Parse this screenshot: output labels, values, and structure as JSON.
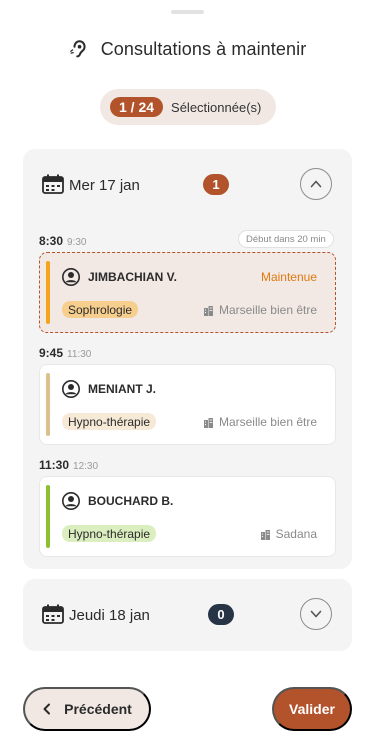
{
  "header": {
    "title": "Consultations à maintenir",
    "icon": "ear-icon"
  },
  "selection": {
    "count": "1 / 24",
    "label": "Sélectionnée(s)"
  },
  "days": [
    {
      "label": "Mer 17 jan",
      "count": "1",
      "expanded": true,
      "slots": [
        {
          "start": "8:30",
          "end": "9:30",
          "start_hint": "Début dans 20 min",
          "patient": "JIMBACHIAN V.",
          "status": "Maintenue",
          "therapy": "Sophrologie",
          "place": "Marseille bien être",
          "selected": true,
          "bar_color": "#f5a31b",
          "tag_color": "#f6cf8e"
        },
        {
          "start": "9:45",
          "end": "11:30",
          "patient": "MENIANT J.",
          "therapy": "Hypno-thérapie",
          "place": "Marseille bien être",
          "selected": false,
          "bar_color": "#dcc091",
          "tag_color": "#f6e9d6"
        },
        {
          "start": "11:30",
          "end": "12:30",
          "patient": "BOUCHARD B.",
          "therapy": "Hypno-thérapie",
          "place": "Sadana",
          "selected": false,
          "bar_color": "#8cc02d",
          "tag_color": "#dbeec0"
        }
      ]
    },
    {
      "label": "Jeudi 18 jan",
      "count": "0",
      "expanded": false
    }
  ],
  "footer": {
    "prev_label": "Précédent",
    "next_label": "Valider"
  },
  "colors": {
    "accent": "#b2532b",
    "dark_badge": "#263445",
    "status_orange": "#e07a10"
  }
}
